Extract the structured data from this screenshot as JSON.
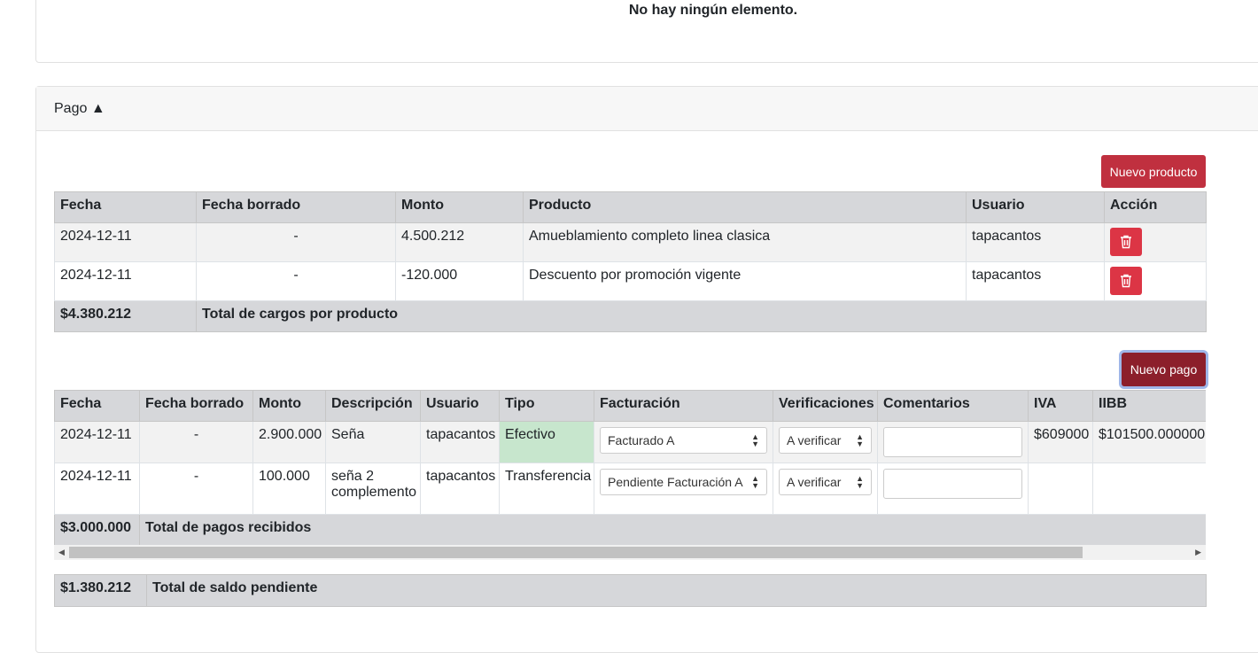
{
  "top_card": {
    "empty_message": "No hay ningún elemento."
  },
  "pago_section": {
    "title": "Pago ▲"
  },
  "products": {
    "new_button": "Nuevo producto",
    "headers": [
      "Fecha",
      "Fecha borrado",
      "Monto",
      "Producto",
      "Usuario",
      "Acción"
    ],
    "rows": [
      {
        "fecha": "2024-12-11",
        "fecha_borrado": "-",
        "monto": "4.500.212",
        "producto": "Amueblamiento completo linea clasica",
        "usuario": "tapacantos"
      },
      {
        "fecha": "2024-12-11",
        "fecha_borrado": "-",
        "monto": "-120.000",
        "producto": "Descuento por promoción vigente",
        "usuario": "tapacantos"
      }
    ],
    "total_value": "$4.380.212",
    "total_label": "Total de cargos por producto"
  },
  "payments": {
    "new_button": "Nuevo pago",
    "headers": [
      "Fecha",
      "Fecha borrado",
      "Monto",
      "Descripción",
      "Usuario",
      "Tipo",
      "Facturación",
      "Verificaciones",
      "Comentarios",
      "IVA",
      "IIBB"
    ],
    "rows": [
      {
        "fecha": "2024-12-11",
        "fecha_borrado": "-",
        "monto": "2.900.000",
        "descripcion": "Seña",
        "usuario": "tapacantos",
        "tipo": "Efectivo",
        "facturacion": "Facturado A",
        "verificacion": "A verificar",
        "iva": "$609000",
        "iibb": "$101500.000000"
      },
      {
        "fecha": "2024-12-11",
        "fecha_borrado": "-",
        "monto": "100.000",
        "descripcion": "seña 2 complemento",
        "usuario": "tapacantos",
        "tipo": "Transferencia",
        "facturacion": "Pendiente Facturación A",
        "verificacion": "A verificar",
        "iva": "",
        "iibb": ""
      }
    ],
    "total_value": "$3.000.000",
    "total_label": "Total de pagos recibidos"
  },
  "balance": {
    "value": "$1.380.212",
    "label": "Total de saldo pendiente"
  },
  "colors": {
    "danger": "#dc3545",
    "accent_dark": "#8c1f2b",
    "efectivo_bg": "#c7e6cd"
  }
}
